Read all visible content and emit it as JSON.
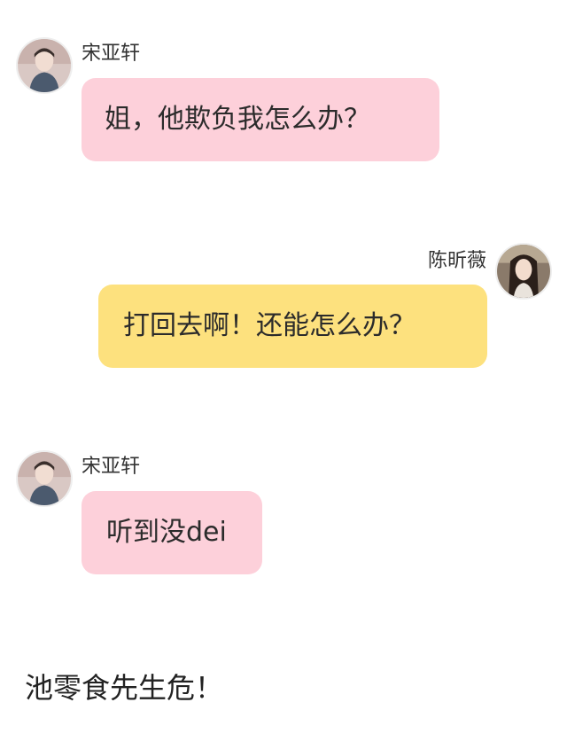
{
  "messages": [
    {
      "sender": "宋亚轩",
      "text": "姐，他欺负我怎么办？",
      "side": "left",
      "bubble_color": "#fdd0da"
    },
    {
      "sender": "陈昕薇",
      "text": "打回去啊！还能怎么办？",
      "side": "right",
      "bubble_color": "#fde17e"
    },
    {
      "sender": "宋亚轩",
      "text": "听到没dei",
      "side": "left",
      "bubble_color": "#fdd0da"
    }
  ],
  "caption": "池零食先生危！"
}
